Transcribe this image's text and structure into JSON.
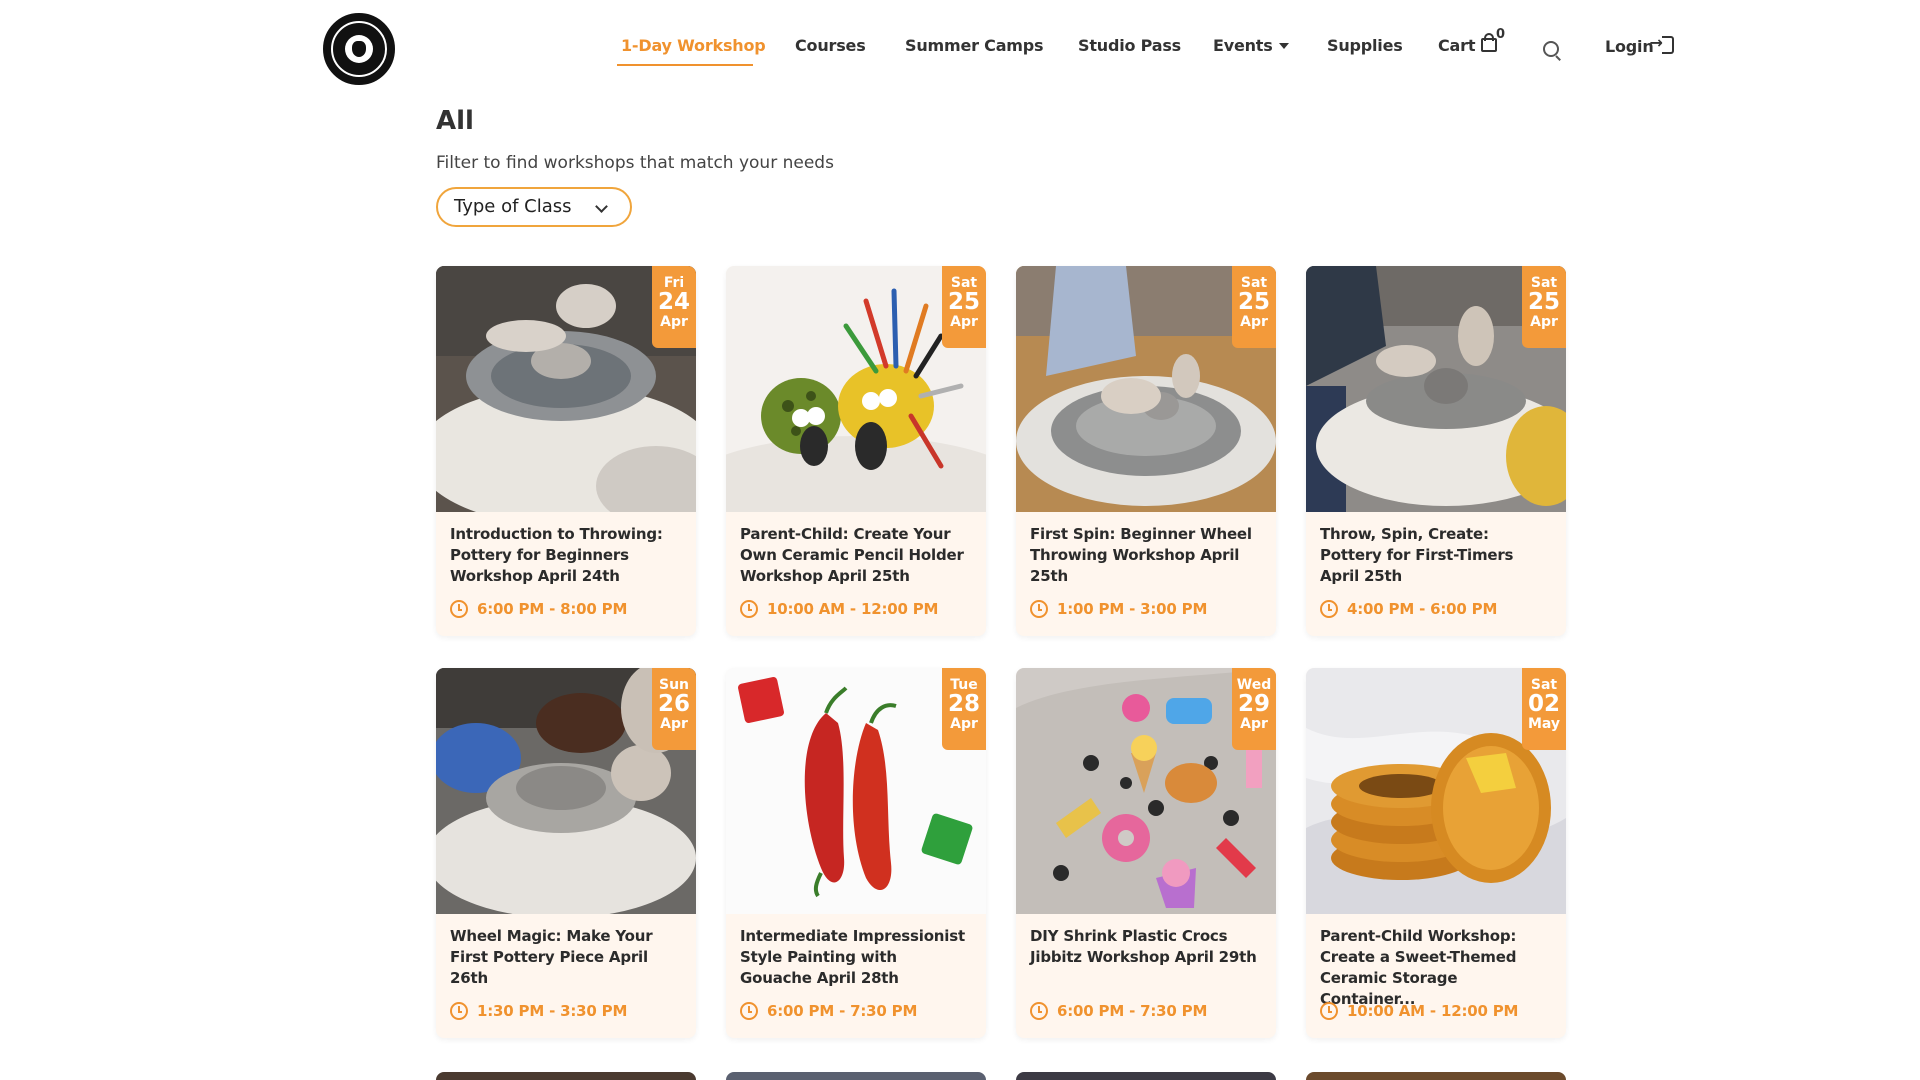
{
  "header": {
    "logo_alt": "Happy Hands logo",
    "nav": [
      {
        "label": "1-Day Workshop",
        "active": true
      },
      {
        "label": "Courses"
      },
      {
        "label": "Summer Camps"
      },
      {
        "label": "Studio Pass"
      },
      {
        "label": "Events"
      },
      {
        "label": "Supplies"
      },
      {
        "label": "Cart"
      }
    ],
    "cart_count": "0",
    "login_label": "Login"
  },
  "main": {
    "title": "All",
    "filter_hint": "Filter to find workshops that match your needs",
    "filter_select": "Type of Class"
  },
  "workshops": [
    {
      "dow": "Fri",
      "day": "24",
      "month": "Apr",
      "title": "Introduction to Throwing: Pottery for Beginners Workshop April 24th",
      "time": "6:00 PM - 8:00 PM"
    },
    {
      "dow": "Sat",
      "day": "25",
      "month": "Apr",
      "title": "Parent-Child: Create Your Own Ceramic Pencil Holder Workshop April 25th",
      "time": "10:00 AM - 12:00 PM"
    },
    {
      "dow": "Sat",
      "day": "25",
      "month": "Apr",
      "title": "First Spin: Beginner Wheel Throwing Workshop April 25th",
      "time": "1:00 PM - 3:00 PM"
    },
    {
      "dow": "Sat",
      "day": "25",
      "month": "Apr",
      "title": "Throw, Spin, Create: Pottery for First-Timers April 25th",
      "time": "4:00 PM - 6:00 PM"
    },
    {
      "dow": "Sun",
      "day": "26",
      "month": "Apr",
      "title": "Wheel Magic: Make Your First Pottery Piece April 26th",
      "time": "1:30 PM - 3:30 PM"
    },
    {
      "dow": "Tue",
      "day": "28",
      "month": "Apr",
      "title": "Intermediate Impressionist Style Painting with Gouache April 28th",
      "time": "6:00 PM - 7:30 PM"
    },
    {
      "dow": "Wed",
      "day": "29",
      "month": "Apr",
      "title": "DIY Shrink Plastic Crocs Jibbitz Workshop April 29th",
      "time": "6:00 PM - 7:30 PM"
    },
    {
      "dow": "Sat",
      "day": "02",
      "month": "May",
      "title": "Parent-Child Workshop: Create a Sweet-Themed Ceramic Storage Container...",
      "time": "10:00 AM - 12:00 PM"
    }
  ],
  "colors": {
    "accent": "#f0922e",
    "badge": "#f39a3a",
    "card_bg": "#fff6ee"
  },
  "icons": [
    "search-icon",
    "cart-icon",
    "login-icon",
    "clock-icon",
    "chevron-down-icon",
    "caret-down-icon"
  ]
}
